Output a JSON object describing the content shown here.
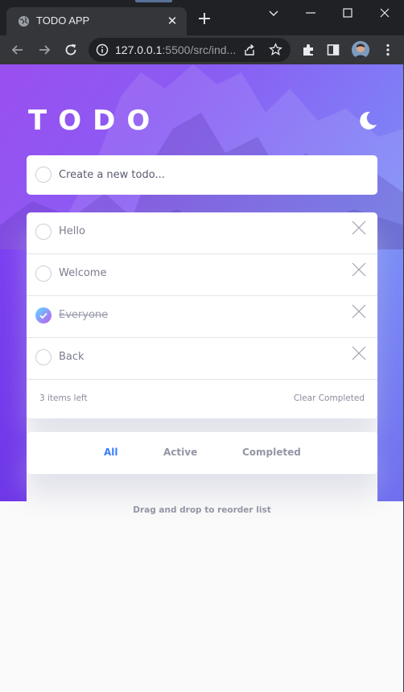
{
  "browser": {
    "tab_title": "TODO APP",
    "url_host": "127.0.0.1",
    "url_rest": ":5500/src/ind..."
  },
  "app": {
    "logo": "TODO",
    "new_todo_placeholder": "Create a new todo...",
    "todos": [
      {
        "text": "Hello",
        "completed": false
      },
      {
        "text": "Welcome",
        "completed": false
      },
      {
        "text": "Everyone",
        "completed": true
      },
      {
        "text": "Back",
        "completed": false
      }
    ],
    "items_left": "3 items left",
    "clear_completed": "Clear Completed",
    "filters": [
      "All",
      "Active",
      "Completed"
    ],
    "active_filter": "All",
    "hint": "Drag and drop to reorder list"
  },
  "colors": {
    "accent": "#3a7cfd",
    "check_gradient_start": "#57ddff",
    "check_gradient_end": "#c058f3"
  }
}
